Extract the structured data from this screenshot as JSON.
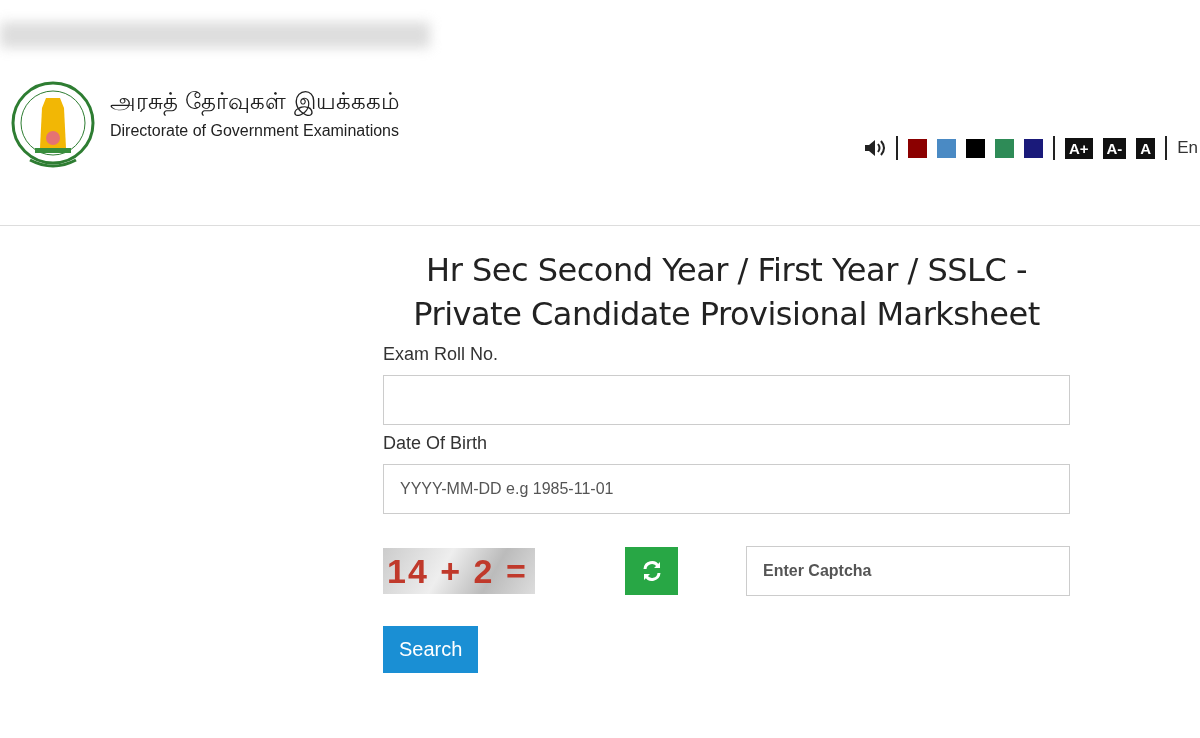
{
  "header": {
    "title_tamil": "அரசுத் தேர்வுகள் இயக்ககம்",
    "title_english": "Directorate of Government Examinations"
  },
  "toolbar": {
    "swatches": [
      {
        "color": "#8b0000"
      },
      {
        "color": "#4a8ac4"
      },
      {
        "color": "#000000"
      },
      {
        "color": "#2e8b57"
      },
      {
        "color": "#1a1a7a"
      }
    ],
    "font_buttons": [
      "A+",
      "A-",
      "A"
    ],
    "language": "En"
  },
  "form": {
    "title_line_1": "Hr Sec Second Year / First Year / SSLC -",
    "title_line_2": "Private Candidate Provisional Marksheet",
    "fields": [
      {
        "label": "Exam Roll No."
      },
      {
        "label": "Date Of Birth",
        "placeholder": "YYYY-MM-DD e.g 1985-11-01"
      }
    ],
    "captcha_text": "14 + 2 =",
    "captcha_placeholder": "Enter Captcha",
    "submit": "Search"
  }
}
